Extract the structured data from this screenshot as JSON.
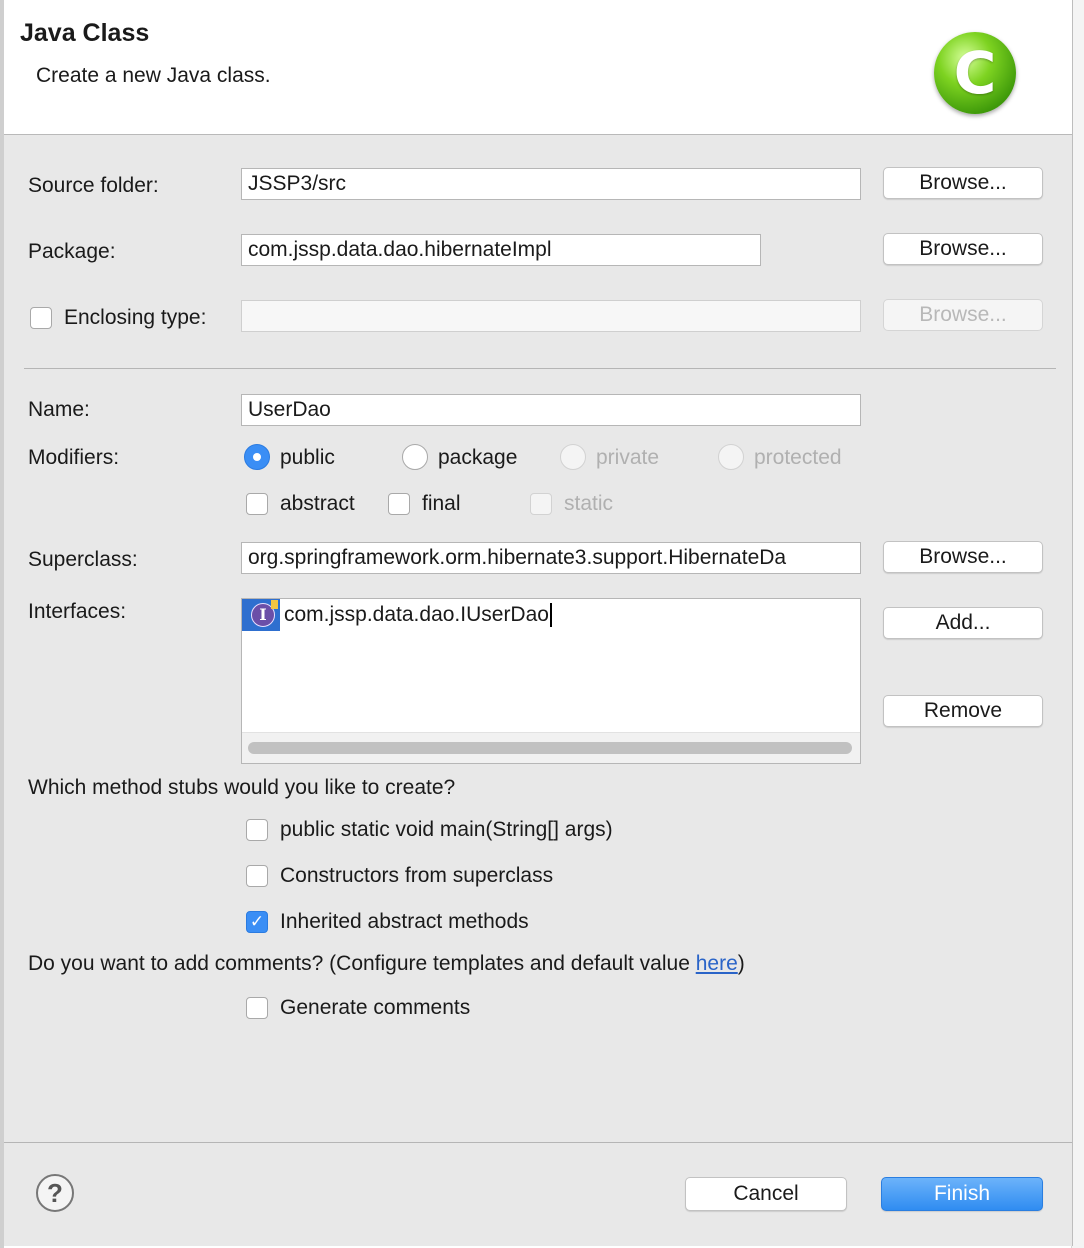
{
  "dialog": {
    "title": "Java Class",
    "subtitle": "Create a new Java class.",
    "icon": "java-class-wizard-icon"
  },
  "source_folder": {
    "label": "Source folder:",
    "value": "JSSP3/src",
    "browse_label": "Browse..."
  },
  "package": {
    "label": "Package:",
    "value": "com.jssp.data.dao.hibernateImpl",
    "browse_label": "Browse..."
  },
  "enclosing_type": {
    "label": "Enclosing type:",
    "checked": false,
    "value": "",
    "browse_label": "Browse..."
  },
  "name": {
    "label": "Name:",
    "value": "UserDao"
  },
  "modifiers": {
    "label": "Modifiers:",
    "access": [
      {
        "label": "public",
        "selected": true,
        "enabled": true
      },
      {
        "label": "package",
        "selected": false,
        "enabled": true
      },
      {
        "label": "private",
        "selected": false,
        "enabled": false
      },
      {
        "label": "protected",
        "selected": false,
        "enabled": false
      }
    ],
    "flags": [
      {
        "label": "abstract",
        "checked": false,
        "enabled": true
      },
      {
        "label": "final",
        "checked": false,
        "enabled": true
      },
      {
        "label": "static",
        "checked": false,
        "enabled": false
      }
    ]
  },
  "superclass": {
    "label": "Superclass:",
    "value": "org.springframework.orm.hibernate3.support.HibernateDa",
    "browse_label": "Browse..."
  },
  "interfaces": {
    "label": "Interfaces:",
    "items": [
      "com.jssp.data.dao.IUserDao"
    ],
    "add_label": "Add...",
    "remove_label": "Remove"
  },
  "method_stubs": {
    "question": "Which method stubs would you like to create?",
    "options": [
      {
        "label": "public static void main(String[] args)",
        "checked": false
      },
      {
        "label": "Constructors from superclass",
        "checked": false
      },
      {
        "label": "Inherited abstract methods",
        "checked": true
      }
    ]
  },
  "comments": {
    "question_prefix": "Do you want to add comments? (Configure templates and default value ",
    "link_text": "here",
    "question_suffix": ")",
    "option_label": "Generate comments",
    "checked": false
  },
  "footer": {
    "help_label": "?",
    "cancel_label": "Cancel",
    "finish_label": "Finish"
  },
  "colors": {
    "accent": "#3a8ef5",
    "link": "#2a64c8",
    "dialog_bg": "#e8e8e8"
  }
}
